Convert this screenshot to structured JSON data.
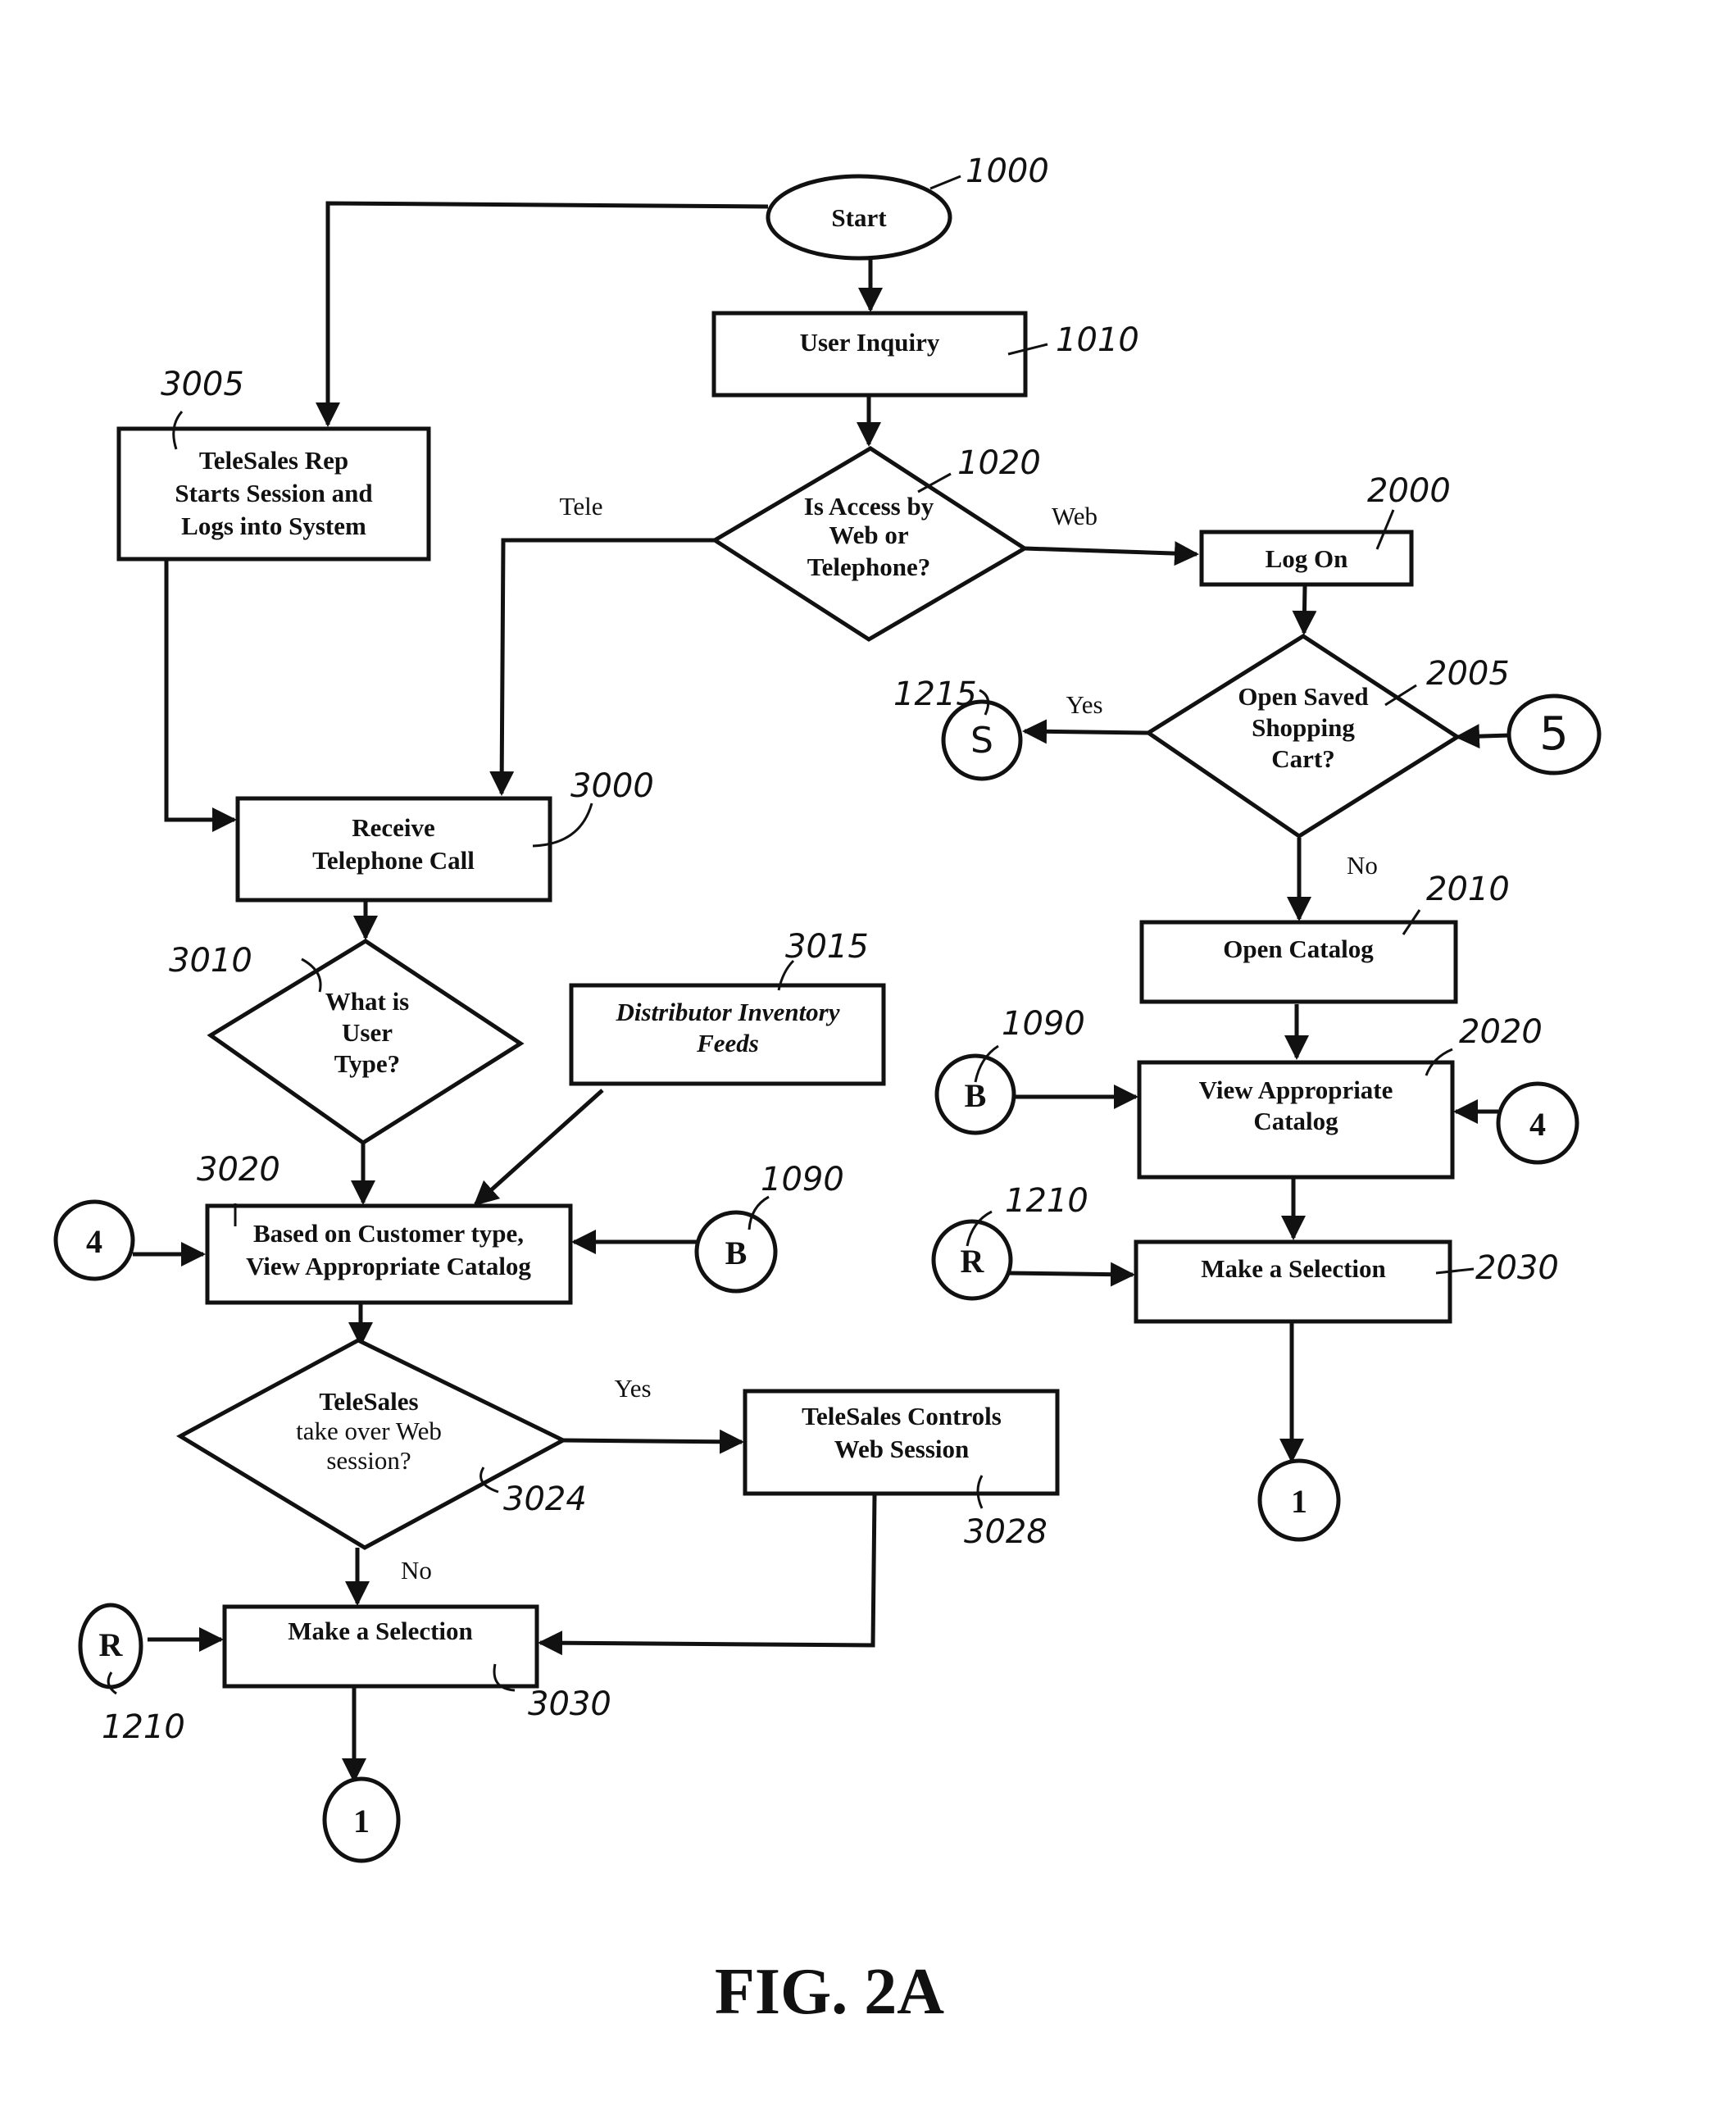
{
  "figure": {
    "caption": "FIG. 2A",
    "nodes": {
      "start": {
        "ref": "1000",
        "lines": [
          "Start"
        ]
      },
      "user_inquiry": {
        "ref": "1010",
        "lines": [
          "User Inquiry"
        ]
      },
      "access_decision": {
        "ref": "1020",
        "lines": [
          "Is Access by",
          "Web or",
          "Telephone?"
        ]
      },
      "log_on": {
        "ref": "2000",
        "lines": [
          "Log On"
        ]
      },
      "open_saved_cart": {
        "ref": "2005",
        "lines": [
          "Open Saved",
          "Shopping",
          "Cart?"
        ]
      },
      "open_catalog": {
        "ref": "2010",
        "lines": [
          "Open Catalog"
        ]
      },
      "view_catalog_web": {
        "ref": "2020",
        "lines": [
          "View Appropriate",
          "Catalog"
        ]
      },
      "make_selection_web": {
        "ref": "2030",
        "lines": [
          "Make a Selection"
        ]
      },
      "telesales_rep": {
        "ref": "3005",
        "lines": [
          "TeleSales Rep",
          "Starts Session and",
          "Logs into System"
        ]
      },
      "receive_call": {
        "ref": "3000",
        "lines": [
          "Receive",
          "Telephone Call"
        ]
      },
      "user_type": {
        "ref": "3010",
        "lines": [
          "What is",
          "User",
          "Type?"
        ]
      },
      "distributor_feeds": {
        "ref": "3015",
        "lines": [
          "Distributor Inventory",
          "Feeds"
        ]
      },
      "view_catalog_tele": {
        "ref": "3020",
        "lines": [
          "Based on Customer type,",
          "View Appropriate Catalog"
        ]
      },
      "takeover_decision": {
        "ref": "3024",
        "lines": [
          "TeleSales",
          "take over Web",
          "session?"
        ]
      },
      "telesales_controls": {
        "ref": "3028",
        "lines": [
          "TeleSales Controls",
          "Web Session"
        ]
      },
      "make_selection_tele": {
        "ref": "3030",
        "lines": [
          "Make a Selection"
        ]
      }
    },
    "connectors": {
      "s_right": {
        "label": "S",
        "ref": "1215"
      },
      "five_right": {
        "label": "5"
      },
      "b_right": {
        "label": "B",
        "ref": "1090"
      },
      "four_right": {
        "label": "4"
      },
      "r_right": {
        "label": "R",
        "ref": "1210"
      },
      "one_right": {
        "label": "1"
      },
      "four_left": {
        "label": "4"
      },
      "b_left": {
        "label": "B",
        "ref": "1090"
      },
      "r_left": {
        "label": "R",
        "ref": "1210"
      },
      "one_left": {
        "label": "1"
      }
    },
    "edge_labels": {
      "tele": "Tele",
      "web": "Web",
      "yes_cart": "Yes",
      "no_cart": "No",
      "yes_takeover": "Yes",
      "no_takeover": "No"
    }
  }
}
